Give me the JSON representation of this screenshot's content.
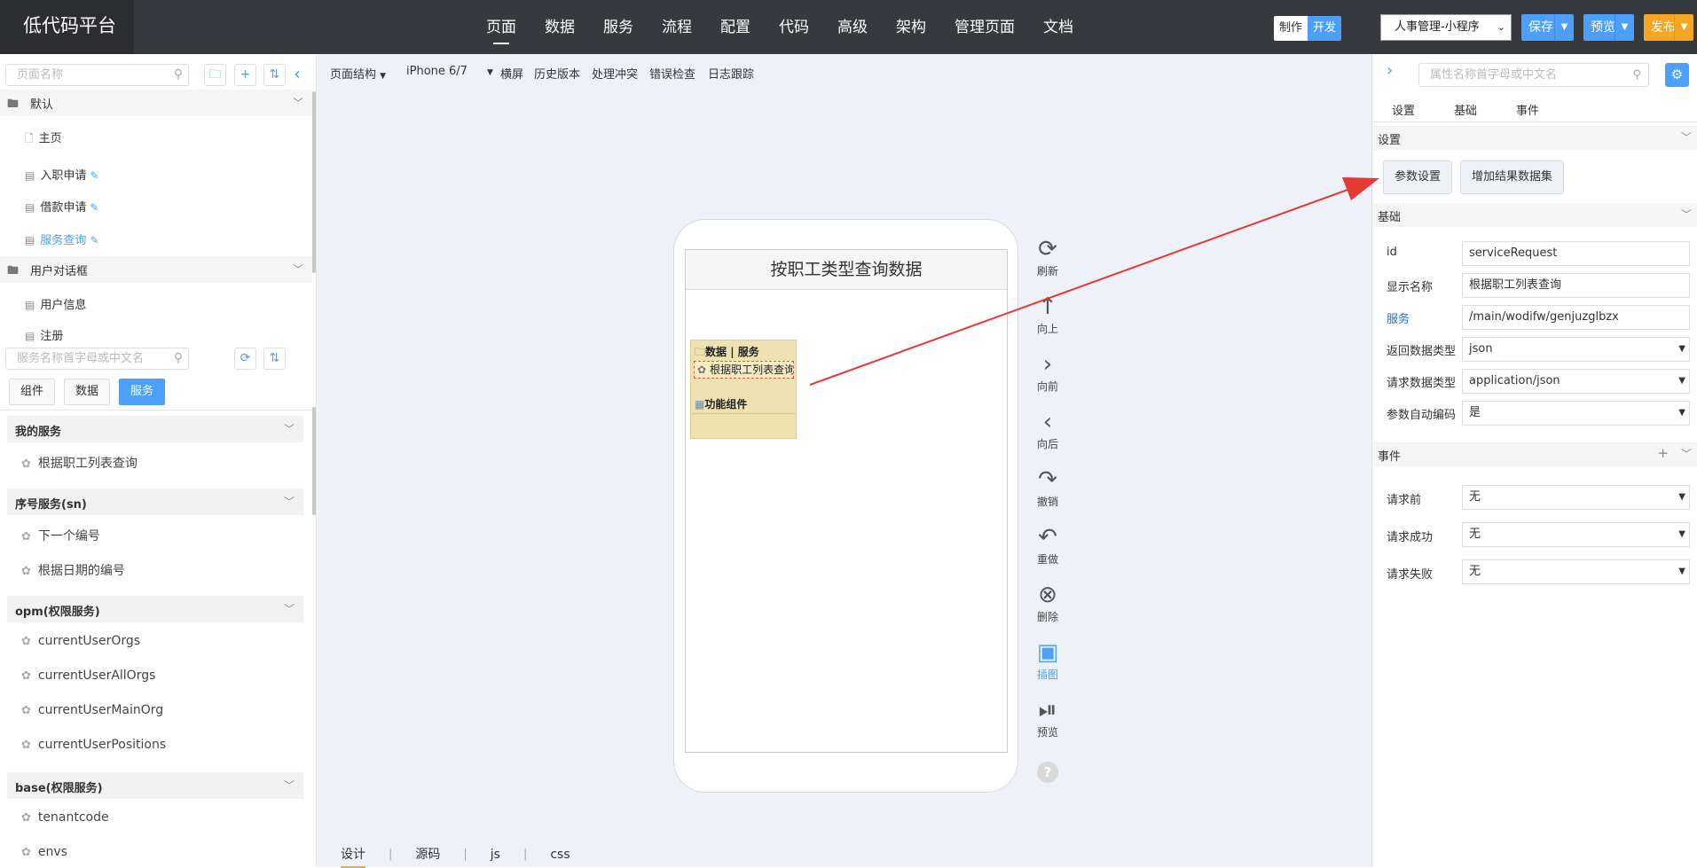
{
  "brand": "低代码平台",
  "nav": [
    "页面",
    "数据",
    "服务",
    "流程",
    "配置",
    "代码",
    "高级",
    "架构",
    "管理页面",
    "文档"
  ],
  "mode": {
    "make": "制作",
    "dev": "开发"
  },
  "app_select": "人事管理-小程序",
  "buttons": {
    "save": "保存",
    "preview": "预览",
    "publish": "发布"
  },
  "left": {
    "page_search_placeholder": "页面名称",
    "groups": [
      {
        "label": "默认",
        "items": [
          "主页",
          "入职申请",
          "借款申请",
          "服务查询"
        ]
      },
      {
        "label": "用户对话框",
        "items": [
          "用户信息",
          "注册"
        ]
      }
    ],
    "service_search_placeholder": "服务名称首字母或中文名",
    "tabs": [
      "组件",
      "数据",
      "服务"
    ],
    "service_groups": [
      {
        "label": "我的服务",
        "items": [
          "根据职工列表查询"
        ]
      },
      {
        "label": "序号服务(sn)",
        "items": [
          "下一个编号",
          "根据日期的编号"
        ]
      },
      {
        "label": "opm(权限服务)",
        "items": [
          "currentUserOrgs",
          "currentUserAllOrgs",
          "currentUserMainOrg",
          "currentUserPositions"
        ]
      },
      {
        "label": "base(权限服务)",
        "items": [
          "tenantcode",
          "envs"
        ]
      }
    ]
  },
  "canvas": {
    "toolbar": {
      "structure": "页面结构",
      "device": "iPhone 6/7",
      "landscape": "横屏",
      "history": "历史版本",
      "conflict": "处理冲突",
      "check": "错误检查",
      "log": "日志跟踪"
    },
    "screen_title": "按职工类型查询数据",
    "comp_title": "数据 | 服务",
    "comp_service": "根据职工列表查询",
    "comp_func": "功能组件",
    "tools": [
      "刷新",
      "向上",
      "向前",
      "向后",
      "撤销",
      "重做",
      "删除",
      "插图",
      "预览"
    ],
    "help": "?",
    "bottom_tabs": [
      "设计",
      "源码",
      "js",
      "css"
    ]
  },
  "right": {
    "search_placeholder": "属性名称首字母或中文名",
    "tabs": [
      "设置",
      "基础",
      "事件"
    ],
    "sections": {
      "settings": "设置",
      "basic": "基础",
      "events": "事件"
    },
    "setting_buttons": [
      "参数设置",
      "增加结果数据集"
    ],
    "props": [
      {
        "label": "id",
        "value": "serviceRequest"
      },
      {
        "label": "显示名称",
        "value": "根据职工列表查询"
      },
      {
        "label": "服务",
        "value": "/main/wodifw/genjuzglbzx"
      },
      {
        "label": "返回数据类型",
        "value": "json"
      },
      {
        "label": "请求数据类型",
        "value": "application/json"
      },
      {
        "label": "参数自动编码",
        "value": "是"
      }
    ],
    "events": [
      {
        "label": "请求前",
        "value": "无"
      },
      {
        "label": "请求成功",
        "value": "无"
      },
      {
        "label": "请求失败",
        "value": "无"
      }
    ]
  },
  "colors": {
    "accent": "#4c9ffa",
    "publish": "#f5a623",
    "topbar": "#36393e",
    "arrow": "#e53935",
    "component_bg": "#efe2b0"
  }
}
